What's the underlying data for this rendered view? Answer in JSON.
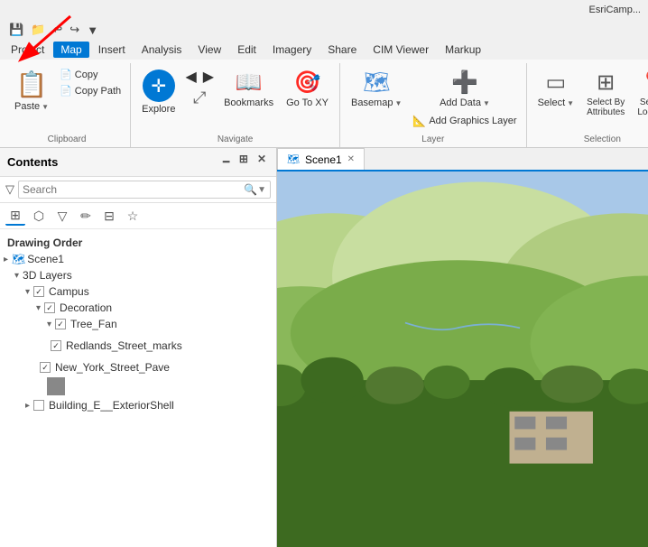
{
  "app": {
    "title": "EsriCamp...",
    "red_arrow_visible": true
  },
  "titlebar": {
    "title": "EsriCamp..."
  },
  "quickaccess": {
    "buttons": [
      "💾",
      "📁",
      "↩",
      "↪",
      "▼"
    ]
  },
  "menubar": {
    "items": [
      {
        "label": "Project",
        "active": false
      },
      {
        "label": "Map",
        "active": true
      },
      {
        "label": "Insert",
        "active": false
      },
      {
        "label": "Analysis",
        "active": false
      },
      {
        "label": "View",
        "active": false
      },
      {
        "label": "Edit",
        "active": false
      },
      {
        "label": "Imagery",
        "active": false
      },
      {
        "label": "Share",
        "active": false
      },
      {
        "label": "CIM Viewer",
        "active": false
      },
      {
        "label": "Markup",
        "active": false
      }
    ]
  },
  "ribbon": {
    "groups": [
      {
        "name": "clipboard",
        "label": "Clipboard",
        "buttons_large": [
          {
            "label": "Paste",
            "icon": "📋",
            "has_dropdown": true
          }
        ],
        "buttons_small": [
          {
            "label": "Copy",
            "icon": "📄"
          },
          {
            "label": "Copy Path",
            "icon": "📄"
          }
        ]
      },
      {
        "name": "navigate",
        "label": "Navigate",
        "buttons": [
          {
            "label": "Explore",
            "icon": "🔵",
            "large": true
          },
          {
            "label": "⬅➡\n⬆⬇",
            "icon": "◀▶",
            "large": true
          },
          {
            "label": "Bookmarks",
            "icon": "📖",
            "large": true
          },
          {
            "label": "Go To XY",
            "icon": "🎯",
            "large": true
          }
        ]
      },
      {
        "name": "layer",
        "label": "Layer",
        "buttons": [
          {
            "label": "Basemap",
            "icon": "🗺",
            "large": true
          },
          {
            "label": "Add Data",
            "icon": "➕",
            "large": true
          },
          {
            "label": "Add Graphics Layer",
            "icon": "📐",
            "large": false
          }
        ]
      },
      {
        "name": "selection",
        "label": "Selection",
        "buttons": [
          {
            "label": "Select",
            "icon": "▭",
            "large": true
          },
          {
            "label": "Select By Attributes",
            "icon": "▭",
            "large": true
          },
          {
            "label": "Select Locat...",
            "icon": "▭",
            "large": true
          }
        ]
      }
    ]
  },
  "contents": {
    "title": "Contents",
    "search_placeholder": "Search",
    "toolbar_icons": [
      "grid",
      "cylinder",
      "filter",
      "pencil",
      "table",
      "star"
    ],
    "drawing_order_label": "Drawing Order",
    "tree": [
      {
        "indent": 0,
        "expand": "▸",
        "icon": "🗺",
        "label": "Scene1",
        "checkbox": false,
        "checked": false
      },
      {
        "indent": 1,
        "expand": "▾",
        "icon": "",
        "label": "3D Layers",
        "checkbox": false,
        "checked": false
      },
      {
        "indent": 2,
        "expand": "▾",
        "icon": "",
        "label": "Campus",
        "checkbox": true,
        "checked": true
      },
      {
        "indent": 3,
        "expand": "▾",
        "icon": "",
        "label": "Decoration",
        "checkbox": true,
        "checked": true
      },
      {
        "indent": 4,
        "expand": "▾",
        "icon": "",
        "label": "Tree_Fan",
        "checkbox": true,
        "checked": true
      },
      {
        "indent": 4,
        "expand": "",
        "icon": "",
        "label": "Redlands_Street_marks",
        "checkbox": true,
        "checked": true
      },
      {
        "indent": 3,
        "expand": "",
        "icon": "",
        "label": "New_York_Street_Pave",
        "checkbox": true,
        "checked": true
      },
      {
        "indent": 3,
        "has_swatch": true,
        "swatch_color": "#888888",
        "label": ""
      },
      {
        "indent": 2,
        "expand": "▸",
        "icon": "",
        "label": "Building_E__ExteriorShell",
        "checkbox": true,
        "checked": false
      }
    ]
  },
  "map": {
    "tab_label": "Scene1",
    "tab_icon": "🗺"
  }
}
